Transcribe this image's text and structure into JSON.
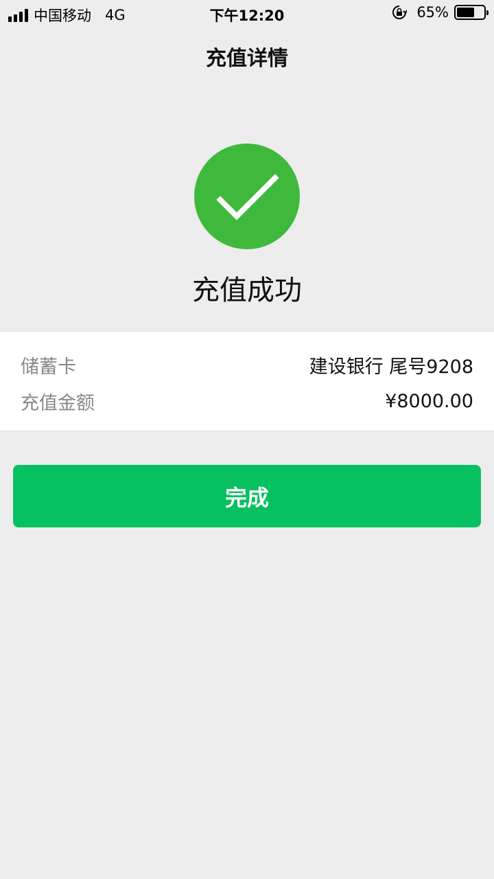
{
  "status_bar": {
    "carrier": "中国移动",
    "network": "4G",
    "time": "下午12:20",
    "battery_percent": "65%",
    "battery_level": 0.65
  },
  "nav": {
    "title": "充值详情"
  },
  "result": {
    "status_text": "充值成功",
    "status_color": "#3fb93c"
  },
  "details": {
    "card_label": "储蓄卡",
    "card_value": "建设银行 尾号9208",
    "amount_label": "充值金额",
    "amount_value": "¥8000.00"
  },
  "actions": {
    "done_label": "完成",
    "done_color": "#07c160"
  }
}
